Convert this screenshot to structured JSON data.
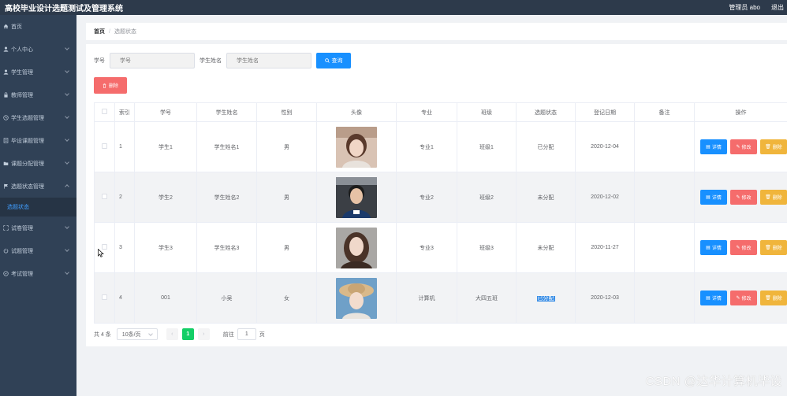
{
  "header": {
    "title": "高校毕业设计选题测试及管理系统",
    "user": "管理员 abo",
    "logout": "退出"
  },
  "sidebar": {
    "items": [
      {
        "label": "首页",
        "icon": "home-icon",
        "has_children": false
      },
      {
        "label": "个人中心",
        "icon": "user-icon",
        "has_children": true
      },
      {
        "label": "学生管理",
        "icon": "user-icon",
        "has_children": true
      },
      {
        "label": "教师管理",
        "icon": "lock-icon",
        "has_children": true
      },
      {
        "label": "学生选题管理",
        "icon": "clock-icon",
        "has_children": true
      },
      {
        "label": "毕设课题管理",
        "icon": "document-icon",
        "has_children": true
      },
      {
        "label": "课题分配管理",
        "icon": "folder-icon",
        "has_children": true
      },
      {
        "label": "选题状态管理",
        "icon": "flag-icon",
        "has_children": true,
        "open": true
      },
      {
        "label": "试卷管理",
        "icon": "expand-icon",
        "has_children": true
      },
      {
        "label": "试题管理",
        "icon": "power-icon",
        "has_children": true
      },
      {
        "label": "考试管理",
        "icon": "compass-icon",
        "has_children": true
      }
    ],
    "active_sub": "选题状态"
  },
  "breadcrumb": {
    "home": "首页",
    "separator": "/",
    "current": "选题状态"
  },
  "search": {
    "student_no_label": "学号",
    "student_no_placeholder": "学号",
    "student_name_label": "学生姓名",
    "student_name_placeholder": "学生姓名",
    "button": "查询"
  },
  "actions": {
    "delete": "删除"
  },
  "table": {
    "columns": [
      "索引",
      "学号",
      "学生姓名",
      "性别",
      "头像",
      "专业",
      "班级",
      "选题状态",
      "登记日期",
      "备注",
      "操作"
    ],
    "rows": [
      {
        "index": "1",
        "student_no": "学生1",
        "name": "学生姓名1",
        "gender": "男",
        "major": "专业1",
        "class": "班级1",
        "status": "已分配",
        "date": "2020-12-04",
        "note": ""
      },
      {
        "index": "2",
        "student_no": "学生2",
        "name": "学生姓名2",
        "gender": "男",
        "major": "专业2",
        "class": "班级2",
        "status": "未分配",
        "date": "2020-12-02",
        "note": ""
      },
      {
        "index": "3",
        "student_no": "学生3",
        "name": "学生姓名3",
        "gender": "男",
        "major": "专业3",
        "class": "班级3",
        "status": "未分配",
        "date": "2020-11-27",
        "note": ""
      },
      {
        "index": "4",
        "student_no": "001",
        "name": "小吴",
        "gender": "女",
        "major": "计算机",
        "class": "大四五班",
        "status": "已分配",
        "date": "2020-12-03",
        "note": ""
      }
    ],
    "op_labels": {
      "detail": "详情",
      "edit": "修改",
      "delete": "删除"
    }
  },
  "pagination": {
    "total": "共 4 条",
    "page_size": "10条/页",
    "current_page": "1",
    "goto_prefix": "前往",
    "goto_value": "1",
    "goto_suffix": "页"
  },
  "watermark": "CSDN @达华计算机毕设",
  "colors": {
    "header_bg": "#2d3a4b",
    "sidebar_bg": "#304156",
    "primary": "#1890ff",
    "danger": "#f56c6c",
    "warning": "#f0b53c",
    "success": "#13ce66"
  }
}
